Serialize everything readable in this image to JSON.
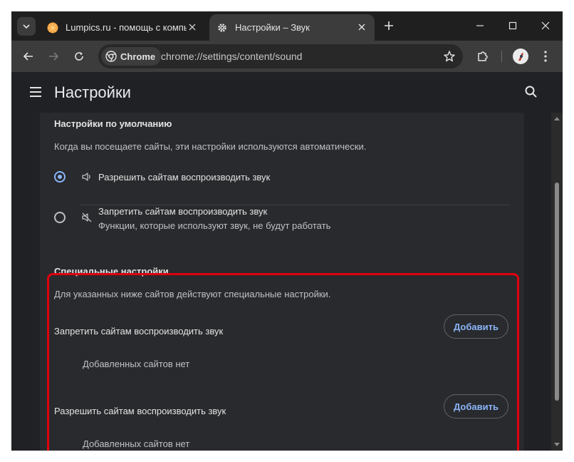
{
  "colors": {
    "accent": "#8ab4f8",
    "highlight_border": "#e0000f",
    "background": "#202124",
    "card": "#292a2d"
  },
  "tabs": [
    {
      "title": "Lumpics.ru - помощь с компьютером",
      "icon": "orange-favicon-icon"
    },
    {
      "title": "Настройки – Звук",
      "icon": "gear-icon"
    }
  ],
  "toolbar": {
    "chip_label": "Chrome",
    "url": "chrome://settings/content/sound"
  },
  "header": {
    "title": "Настройки"
  },
  "defaults": {
    "heading": "Настройки по умолчанию",
    "description": "Когда вы посещаете сайты, эти настройки используются автоматически.",
    "options": [
      {
        "label": "Разрешить сайтам воспроизводить звук",
        "icon": "volume-icon",
        "selected": true
      },
      {
        "label": "Запретить сайтам воспроизводить звук",
        "sublabel": "Функции, которые используют звук, не будут работать",
        "icon": "volume-off-icon",
        "selected": false
      }
    ]
  },
  "custom": {
    "heading": "Специальные настройки",
    "description": "Для указанных ниже сайтов действуют специальные настройки.",
    "sections": [
      {
        "label": "Запретить сайтам воспроизводить звук",
        "button": "Добавить",
        "empty": "Добавленных сайтов нет"
      },
      {
        "label": "Разрешить сайтам воспроизводить звук",
        "button": "Добавить",
        "empty": "Добавленных сайтов нет"
      }
    ]
  }
}
